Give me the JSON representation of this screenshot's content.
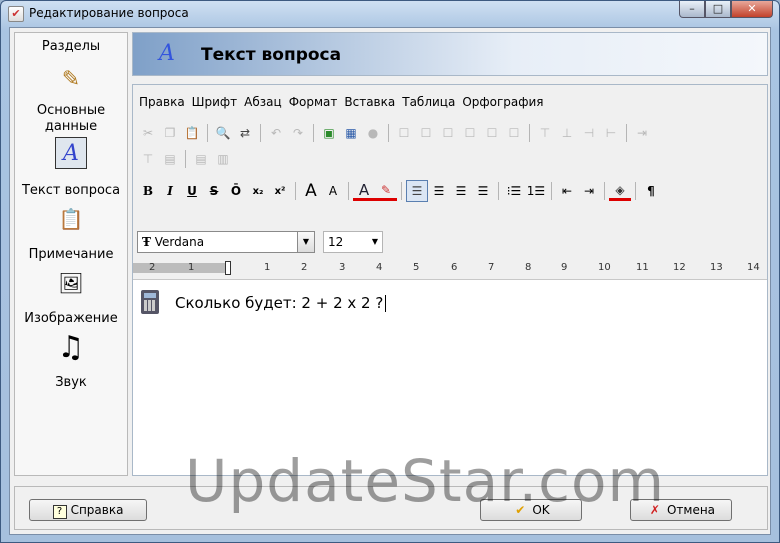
{
  "window": {
    "title": "Редактирование вопроса",
    "min": "–",
    "max": "□",
    "close": "✕"
  },
  "sidebar": {
    "heading": "Разделы",
    "items": [
      {
        "label": "Основные данные",
        "icon": "pencil-icon",
        "glyph": "✎"
      },
      {
        "label": "Текст вопроса",
        "icon": "text-a-icon",
        "glyph": "A"
      },
      {
        "label": "Примечание",
        "icon": "clipboard-icon",
        "glyph": "📋"
      },
      {
        "label": "Изображение",
        "icon": "image-icon",
        "glyph": "🖼"
      },
      {
        "label": "Звук",
        "icon": "music-note-icon",
        "glyph": "♫"
      }
    ]
  },
  "header": {
    "title": "Текст вопроса",
    "glyph": "A"
  },
  "menu": [
    "Правка",
    "Шрифт",
    "Абзац",
    "Формат",
    "Вставка",
    "Таблица",
    "Орфография"
  ],
  "format": {
    "bold": "B",
    "italic": "I",
    "underline": "U",
    "strike": "S",
    "overline": "Ō",
    "sub": "x₂",
    "sup": "x²",
    "grow": "A",
    "shrink": "A",
    "color": "A",
    "highlight": "✎",
    "para": "¶"
  },
  "font": {
    "name": "Verdana",
    "size": "12",
    "glyph": "Ŧ"
  },
  "ruler": [
    "2",
    "1",
    "1",
    "2",
    "3",
    "4",
    "5",
    "6",
    "7",
    "8",
    "9",
    "10",
    "11",
    "12",
    "13",
    "14"
  ],
  "content": {
    "question": "Сколько будет: 2 + 2 x 2 ?"
  },
  "buttons": {
    "help": "Справка",
    "ok": "OK",
    "cancel": "Отмена",
    "help_glyph": "?",
    "ok_glyph": "✔",
    "cancel_glyph": "✗"
  },
  "watermark": "UpdateStar.com"
}
